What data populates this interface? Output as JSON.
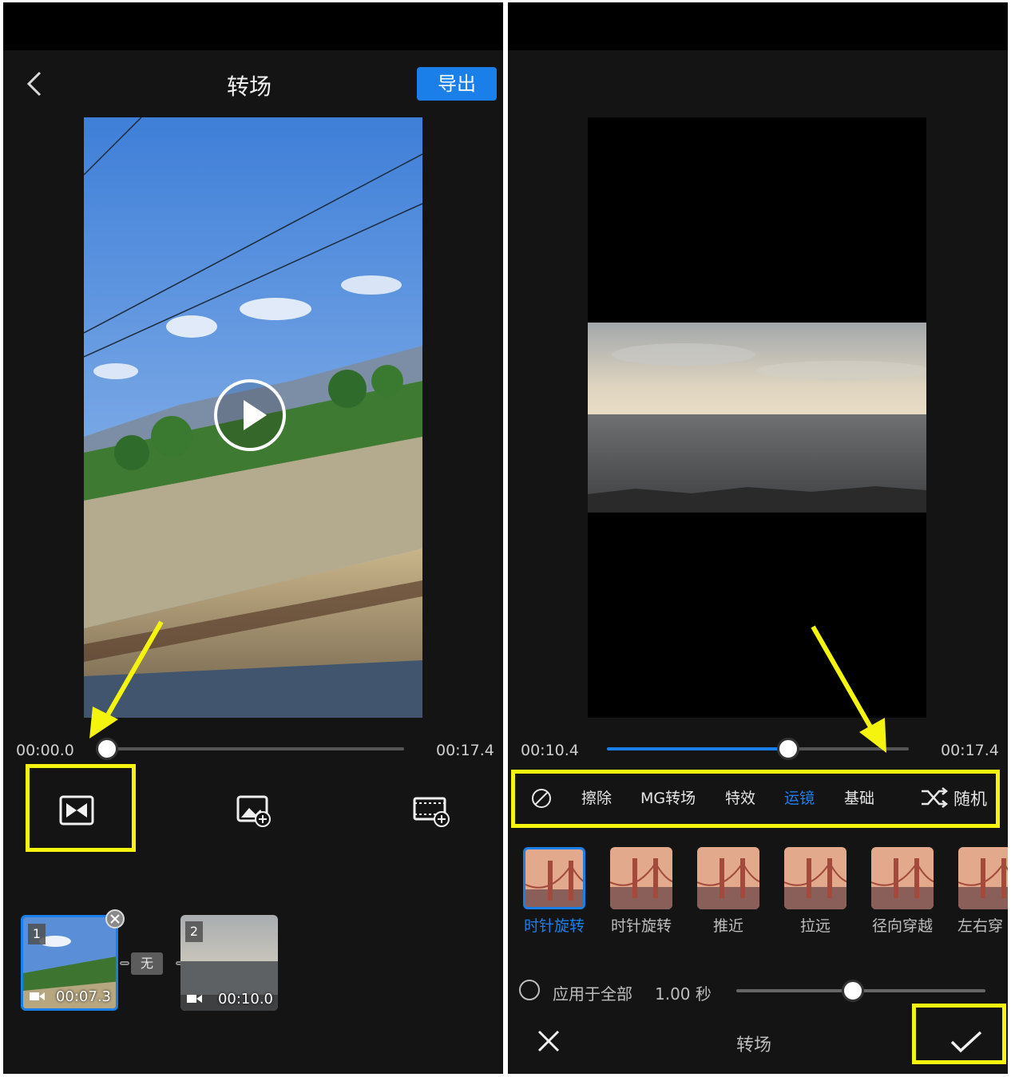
{
  "left": {
    "header": {
      "title": "转场",
      "export_label": "导出"
    },
    "player": {
      "time_start": "00:00.0",
      "time_end": "00:17.4",
      "progress": 0.0
    },
    "toolbar": {
      "labels": [
        "",
        "",
        ""
      ]
    },
    "clips": [
      {
        "index": "1",
        "duration": "00:07.3"
      },
      {
        "index": "2",
        "duration": "00:10.0"
      }
    ],
    "transition_badge": "无"
  },
  "right": {
    "player": {
      "time_current": "00:10.4",
      "time_end": "00:17.4",
      "progress": 0.6
    },
    "categories": [
      "擦除",
      "MG转场",
      "特效",
      "运镜",
      "基础"
    ],
    "active_category": "运镜",
    "random_label": "随机",
    "effects": [
      "时针旋转",
      "时针旋转",
      "推近",
      "拉远",
      "径向穿越",
      "左右穿"
    ],
    "apply_all_label": "应用于全部",
    "duration_value": "1.00 秒",
    "duration_progress": 0.47,
    "bottom_title": "转场"
  },
  "colors": {
    "accent": "#1a7fe8",
    "highlight": "#f4f40f",
    "background": "#141414"
  },
  "icons": [
    "back-icon",
    "play-icon",
    "transition-icon",
    "add-image-icon",
    "add-video-icon",
    "none-icon",
    "shuffle-icon",
    "video-icon",
    "close-icon",
    "check-icon",
    "remove-icon"
  ]
}
